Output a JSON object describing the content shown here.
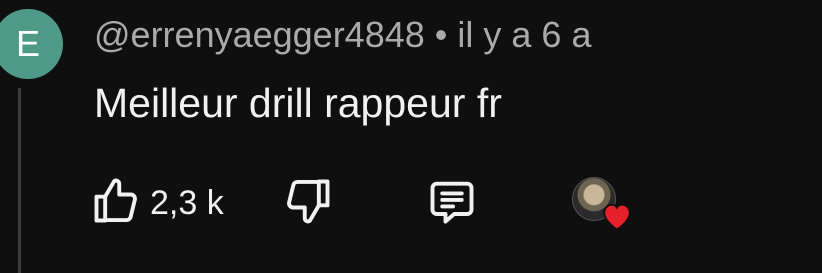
{
  "comment": {
    "avatar_letter": "E",
    "avatar_color": "#4f9a86",
    "author": "@errenyaegger4848",
    "separator": "•",
    "time": "il y a 6 a",
    "text": "Meilleur drill rappeur fr"
  },
  "actions": {
    "like_icon": "thumbs-up-icon",
    "like_count": "2,3 k",
    "dislike_icon": "thumbs-down-icon",
    "reply_icon": "comment-icon",
    "creator_heart_icon": "heart-icon",
    "heart_color": "#e8202c"
  }
}
